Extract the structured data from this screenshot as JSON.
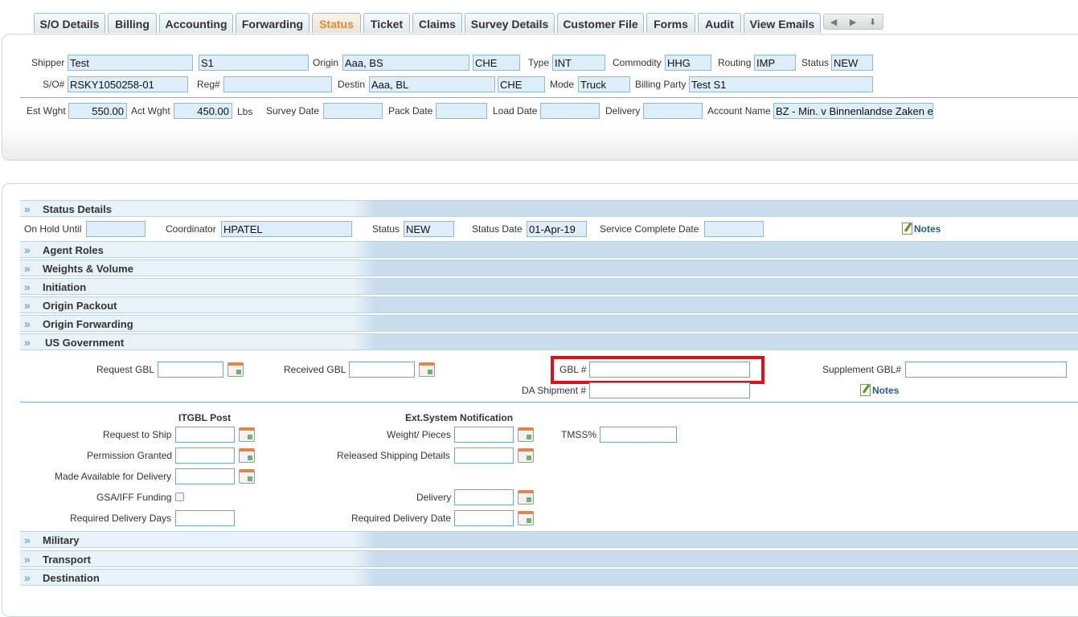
{
  "tabs": [
    "S/O Details",
    "Billing",
    "Accounting",
    "Forwarding",
    "Status",
    "Ticket",
    "Claims",
    "Survey Details",
    "Customer File",
    "Forms",
    "Audit",
    "View Emails"
  ],
  "nav_icons": [
    "prev-arrow-icon",
    "next-arrow-icon",
    "down-arrow-icon"
  ],
  "header": {
    "shipper_label": "Shipper",
    "shipper": "Test",
    "shipper2": "S1",
    "origin_label": "Origin",
    "origin": "Aaa, BS",
    "origin_country": "CHE",
    "type_label": "Type",
    "type": "INT",
    "commodity_label": "Commodity",
    "commodity": "HHG",
    "routing_label": "Routing",
    "routing": "IMP",
    "status_label": "Status",
    "status": "NEW",
    "so_label": "S/O#",
    "so": "RSKY1050258-01",
    "reg_label": "Reg#",
    "reg": "",
    "destin_label": "Destin",
    "destin": "Aaa, BL",
    "destin_country": "CHE",
    "mode_label": "Mode",
    "mode": "Truck",
    "billing_party_label": "Billing Party",
    "billing_party": "Test S1",
    "est_wght_label": "Est Wght",
    "est_wght": "550.00",
    "act_wght_label": "Act Wght",
    "act_wght": "450.00",
    "lbs": "Lbs",
    "survey_date_label": "Survey Date",
    "survey_date": "",
    "pack_date_label": "Pack Date",
    "pack_date": "",
    "load_date_label": "Load Date",
    "load_date": "",
    "delivery_label": "Delivery",
    "delivery": "",
    "account_name_label": "Account Name",
    "account_name": "BZ - Min. v Binnenlandse Zaken e"
  },
  "status_details": {
    "title": "Status Details",
    "on_hold_label": "On Hold Until",
    "on_hold": "",
    "coordinator_label": "Coordinator",
    "coordinator": "HPATEL",
    "status_label": "Status",
    "status": "NEW",
    "status_date_label": "Status Date",
    "status_date": "01-Apr-19",
    "service_complete_label": "Service Complete Date",
    "service_complete": "",
    "notes": "Notes"
  },
  "sections": [
    "Agent Roles",
    "Weights & Volume",
    "Initiation",
    "Origin Packout",
    "Origin Forwarding",
    "US Government"
  ],
  "usgov": {
    "request_gbl_label": "Request GBL",
    "received_gbl_label": "Received GBL",
    "gbl_label": "GBL #",
    "gbl": "",
    "da_shipment_label": "DA Shipment #",
    "da_shipment": "",
    "supplement_gbl_label": "Supplement GBL#",
    "supplement_gbl": "",
    "notes": "Notes",
    "itgbl_title": "ITGBL Post",
    "ext_title": "Ext.System Notification",
    "request_to_ship_label": "Request to Ship",
    "permission_granted_label": "Permission Granted",
    "made_available_label": "Made Available for Delivery",
    "gsa_iff_label": "GSA/IFF Funding",
    "required_delivery_days_label": "Required Delivery Days",
    "weight_pieces_label": "Weight/ Pieces",
    "released_shipping_label": "Released Shipping Details",
    "delivery_label": "Delivery",
    "required_delivery_date_label": "Required Delivery Date",
    "tmss_label": "TMSS%"
  },
  "bottom_sections": [
    "Military",
    "Transport",
    "Destination"
  ]
}
